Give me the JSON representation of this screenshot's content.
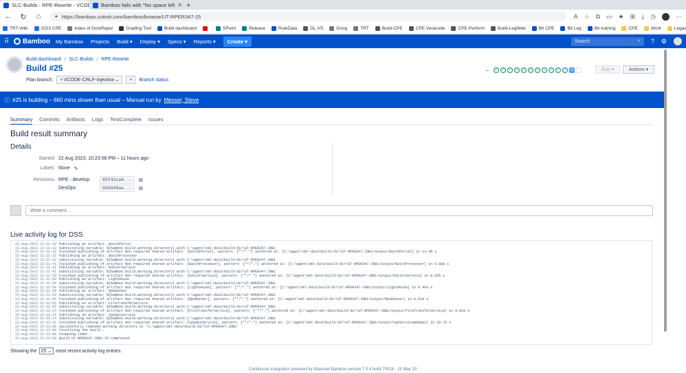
{
  "browser": {
    "tabs": [
      {
        "title": "SLC-Builds - RPE-Rewrite - VCODE",
        "active": true
      },
      {
        "title": "Bamboo fails with \"No space left",
        "active": false
      }
    ],
    "new_tab": "+",
    "url": "https://bamboo.cotiviti.com/bamboo/browse/UT-RPER347-25",
    "zoom_icon": "A",
    "bookmarks": [
      {
        "label": "TRT-Wiki",
        "color": "#1a73e8"
      },
      {
        "label": "2023 CPE",
        "color": "#1a73e8"
      },
      {
        "label": "Index of OctoRepo/",
        "color": "#777777"
      },
      {
        "label": "Grading Tool",
        "color": "#333333"
      },
      {
        "label": "Build dashboard",
        "color": "#0052cc"
      },
      {
        "label": "",
        "color": "#ff0000"
      },
      {
        "label": "SPoint",
        "color": "#038387"
      },
      {
        "label": "Release",
        "color": "#038387"
      },
      {
        "label": "RuleData",
        "color": "#0052cc"
      },
      {
        "label": "DL-VS",
        "color": "#555555"
      },
      {
        "label": "Goog",
        "color": "#777777"
      },
      {
        "label": "TRT",
        "color": "#777777"
      },
      {
        "label": "Build-CPE",
        "color": "#555555"
      },
      {
        "label": "CPE.Veracode",
        "color": "#555555"
      },
      {
        "label": "CPE-Perform",
        "color": "#555555"
      },
      {
        "label": "Build-LegWeb",
        "color": "#555555"
      },
      {
        "label": "Bit CPE",
        "color": "#0052cc"
      },
      {
        "label": "Bit Leg",
        "color": "#0052cc"
      },
      {
        "label": "Bit training",
        "color": "#0052cc"
      },
      {
        "label": "CPE",
        "color": "#f2c94c"
      },
      {
        "label": "Work",
        "color": "#f2c94c"
      },
      {
        "label": "Legacy",
        "color": "#f2c94c"
      }
    ]
  },
  "nav": {
    "brand": "Bamboo",
    "items": [
      "My Bamboo",
      "Projects",
      "Build ▾",
      "Deploy ▾",
      "Specs ▾",
      "Reports ▾"
    ],
    "create": "Create ▾",
    "search_placeholder": "Search"
  },
  "header": {
    "breadcrumbs": [
      "Build dashboard",
      "SLC-Builds",
      "RPE-Rewrite"
    ],
    "title": "Build #25",
    "plan_branch_label": "Plan branch:",
    "plan_branch_value": "VCODE-CRLF-Injection",
    "branch_status": "Branch status",
    "run_label": "Run ▾",
    "actions_label": "Actions ▾",
    "recent_builds": [
      "success",
      "success",
      "success",
      "success",
      "success",
      "success",
      "success",
      "success",
      "success",
      "success",
      "success",
      "current",
      "blank"
    ]
  },
  "banner": {
    "text": "#25 is building – 660 mins slower than usual – Manual run by",
    "user": "Messer, Steve"
  },
  "tabs": [
    "Summary",
    "Commits",
    "Artifacts",
    "Logs",
    "TestComplete",
    "Issues"
  ],
  "summary": {
    "heading": "Build result summary",
    "details_heading": "Details",
    "started_label": "Started",
    "started_value": "22 Aug 2023, 10:23:08 PM – 11 hours ago",
    "labels_label": "Labels",
    "labels_value": "None",
    "revisions_label": "Revisions",
    "revisions": [
      {
        "repo": "RPE - develop",
        "hash": "65f42ca8..."
      },
      {
        "repo": "DevOps",
        "hash": "b5d949ae..."
      }
    ]
  },
  "comment": {
    "placeholder": "Write a comment..."
  },
  "log": {
    "heading": "Live activity log for DSS",
    "lines": [
      [
        "22-Aug-2023 22:31:18",
        "Publishing an artifact: BatchPortal"
      ],
      [
        "22-Aug-2023 22:31:18",
        "Substituting variable: ${bamboo.build.working.directory} with C:\\agent\\xml-data\\build-dir\\UT-RPER347-JOB1"
      ],
      [
        "22-Aug-2023 22:31:32",
        "Finished publishing of artifact Non required shared artifact: [BatchPortal], pattern: [**/*.*] anchored at: [C:\\agent\\xml-data\\build-dir\\UT-RPER347-JOB1/output/BatchPortal] in 13.48 s"
      ],
      [
        "22-Aug-2023 22:31:32",
        "Publishing an artifact: BatchProcessor"
      ],
      [
        "22-Aug-2023 22:31:32",
        "Substituting variable: ${bamboo.build.working.directory} with C:\\agent\\xml-data\\build-dir\\UT-RPER347-JOB1"
      ],
      [
        "22-Aug-2023 22:31:41",
        "Finished publishing of artifact Non required shared artifact: [BatchProcessor], pattern: [**/*.*] anchored at: [C:\\agent\\xml-data\\build-dir\\UT-RPER347-JOB1/output/BatchProcessor] in 9.808 s"
      ],
      [
        "22-Aug-2023 22:31:41",
        "Publishing an artifact: EditorService"
      ],
      [
        "22-Aug-2023 22:31:41",
        "Substituting variable: ${bamboo.build.working.directory} with C:\\agent\\xml-data\\build-dir\\UT-RPER347-JOB1"
      ],
      [
        "22-Aug-2023 22:31:50",
        "Finished publishing of artifact Non required shared artifact: [EditorService], pattern: [**/*.*] anchored at: [C:\\agent\\xml-data\\build-dir\\UT-RPER347-JOB1/output/EditorService] in 9.205 s"
      ],
      [
        "22-Aug-2023 22:31:50",
        "Publishing an artifact: LightHouse"
      ],
      [
        "22-Aug-2023 22:31:50",
        "Substituting variable: ${bamboo.build.working.directory} with C:\\agent\\xml-data\\build-dir\\UT-RPER347-JOB1"
      ],
      [
        "22-Aug-2023 22:31:59",
        "Finished publishing of artifact Non required shared artifact: [LightHouse], pattern: [**/*.*] anchored at: [C:\\agent\\xml-data\\build-dir\\UT-RPER347-JOB1/output/LightHouse] in 8.463 s"
      ],
      [
        "22-Aug-2023 22:31:59",
        "Publishing an artifact: RpeRunner"
      ],
      [
        "22-Aug-2023 22:31:59",
        "Substituting variable: ${bamboo.build.working.directory} with C:\\agent\\xml-data\\build-dir\\UT-RPER347-JOB1"
      ],
      [
        "22-Aug-2023 22:32:05",
        "Finished publishing of artifact Non required shared artifact: [RpeRunner], pattern: [**/*.*] anchored at: [C:\\agent\\xml-data\\build-dir\\UT-RPER347-JOB1/output/RpeRunner] in 6.534 s"
      ],
      [
        "22-Aug-2023 22:32:05",
        "Publishing an artifact: FileTransferService"
      ],
      [
        "22-Aug-2023 22:32:05",
        "Substituting variable: ${bamboo.build.working.directory} with C:\\agent\\xml-data\\build-dir\\UT-RPER347-JOB1"
      ],
      [
        "22-Aug-2023 22:32:14",
        "Finished publishing of artifact Non required shared artifact: [FileTransferService], pattern: [**/*.*] anchored at: [C:\\agent\\xml-data\\build-dir\\UT-RPER347-JOB1/output/FileTransferService] in 9.033 s"
      ],
      [
        "22-Aug-2023 22:32:14",
        "Publishing an artifact: CpeApiService"
      ],
      [
        "22-Aug-2023 22:32:14",
        "Substituting variable: ${bamboo.build.working.directory} with C:\\agent\\xml-data\\build-dir\\UT-RPER347-JOB1"
      ],
      [
        "22-Aug-2023 22:32:25",
        "Finished publishing of artifact Non required shared artifact: [CpeApiService], pattern: [**/*.*] anchored at: [C:\\agent\\xml-data\\build-dir\\UT-RPER347-JOB1/output/CpeServiceWebApi] in 10.76 s"
      ],
      [
        "22-Aug-2023 22:33:00",
        "Successfully removed working directory at 'C:\\agent\\xml-data\\build-dir\\UT-RPER347-JOB1'"
      ],
      [
        "22-Aug-2023 22:33:00",
        "Finalising the build..."
      ],
      [
        "22-Aug-2023 22:33:00",
        "Stopping timer."
      ],
      [
        "22-Aug-2023 22:33:00",
        "Build UT-RPER347-JOB1-25 completed."
      ]
    ],
    "showing_prefix": "Showing the",
    "showing_count": "25",
    "showing_suffix": "most recent activity log entries."
  },
  "footer": "Continuous integration powered by Atlassian Bamboo version 7.0.4 build 70018 - 15 May 20",
  "colors": {
    "primary": "#0052cc",
    "success": "#00875a",
    "current": "#4c9aff"
  }
}
